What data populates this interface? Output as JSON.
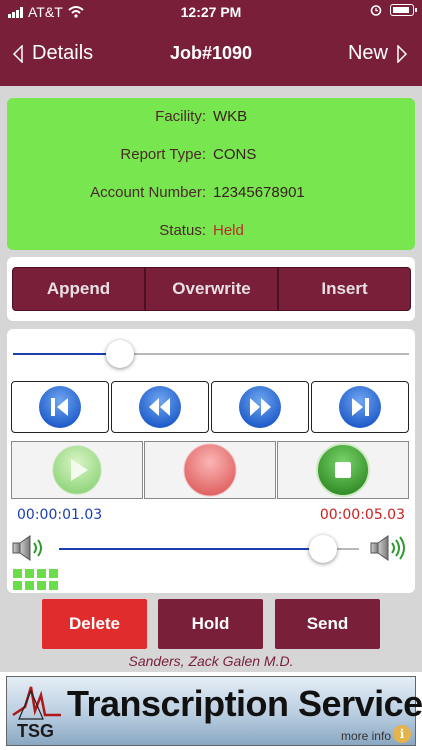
{
  "status_bar": {
    "carrier": "AT&T",
    "time": "12:27 PM"
  },
  "nav": {
    "back_label": "Details",
    "title": "Job#1090",
    "next_label": "New"
  },
  "job_info": {
    "fields": [
      {
        "label": "Facility:",
        "value": "WKB"
      },
      {
        "label": "Report Type:",
        "value": "CONS"
      },
      {
        "label": "Account Number:",
        "value": "12345678901"
      },
      {
        "label": "Status:",
        "value": "Held"
      }
    ],
    "status_color": "#c0292b"
  },
  "mode": {
    "append_label": "Append",
    "overwrite_label": "Overwrite",
    "insert_label": "Insert"
  },
  "player": {
    "position_fraction": 0.27,
    "elapsed": "00:00:01.03",
    "total": "00:00:05.03",
    "volume_fraction": 0.88,
    "transport_icons": [
      "skip-back-icon",
      "rewind-icon",
      "fast-forward-icon",
      "skip-forward-icon"
    ],
    "action_icons": [
      "play-icon",
      "record-icon",
      "stop-icon"
    ]
  },
  "actions": {
    "delete_label": "Delete",
    "hold_label": "Hold",
    "send_label": "Send"
  },
  "author": "Sanders, Zack Galen M.D.",
  "banner": {
    "title": "Transcription Services",
    "logo_text": "TSG",
    "more_info": "more info"
  },
  "colors": {
    "brand": "#7a1f3a",
    "info_bg": "#77e64f",
    "delete": "#e02c2c",
    "elapsed": "#1a3fb0",
    "total": "#cc1f1f"
  }
}
